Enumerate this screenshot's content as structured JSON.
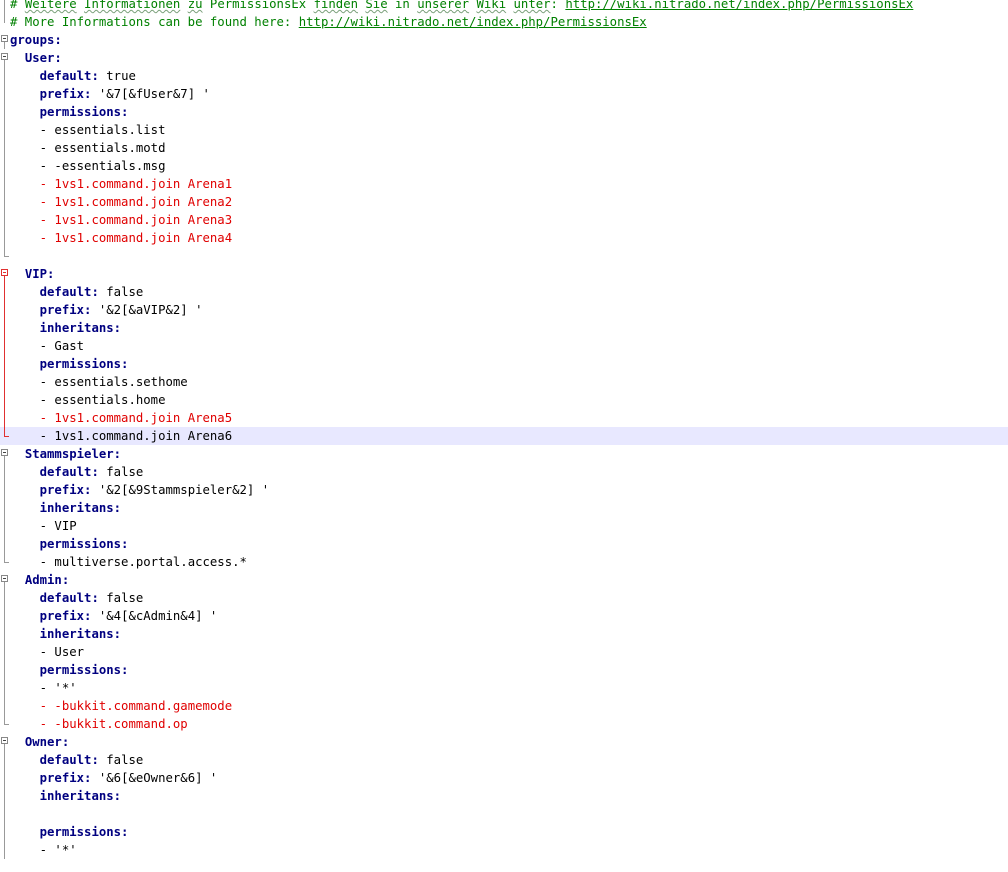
{
  "editor": {
    "current_line": 24,
    "lines": [
      {
        "indent": "",
        "parts": [
          {
            "t": "# ",
            "c": "comment"
          },
          {
            "t": "Weitere",
            "c": "comment-sq"
          },
          {
            "t": " ",
            "c": "comment"
          },
          {
            "t": "Informationen",
            "c": "comment-sq"
          },
          {
            "t": " ",
            "c": "comment"
          },
          {
            "t": "zu",
            "c": "comment-sq"
          },
          {
            "t": " PermissionsEx ",
            "c": "comment"
          },
          {
            "t": "finden",
            "c": "comment-sq"
          },
          {
            "t": " ",
            "c": "comment"
          },
          {
            "t": "Sie",
            "c": "comment-sq"
          },
          {
            "t": " in ",
            "c": "comment"
          },
          {
            "t": "unserer",
            "c": "comment-sq"
          },
          {
            "t": " ",
            "c": "comment"
          },
          {
            "t": "Wiki",
            "c": "comment-sq"
          },
          {
            "t": " ",
            "c": "comment"
          },
          {
            "t": "unter",
            "c": "comment-sq"
          },
          {
            "t": ": ",
            "c": "comment"
          },
          {
            "t": "http://wiki.nitrado.net/index.php/PermissionsEx",
            "c": "link"
          }
        ],
        "g": "vline"
      },
      {
        "indent": "",
        "parts": [
          {
            "t": "# More Informations can be found here: ",
            "c": "comment"
          },
          {
            "t": "http://wiki.nitrado.net/index.php/PermissionsEx",
            "c": "link"
          }
        ],
        "g": "vline-end"
      },
      {
        "indent": "",
        "parts": [
          {
            "t": "groups:",
            "c": "key"
          }
        ],
        "g": "fold"
      },
      {
        "indent": "  ",
        "parts": [
          {
            "t": "User:",
            "c": "key"
          }
        ],
        "g": "fold"
      },
      {
        "indent": "    ",
        "parts": [
          {
            "t": "default:",
            "c": "key"
          },
          {
            "t": " true",
            "c": "val"
          }
        ],
        "g": "vline"
      },
      {
        "indent": "    ",
        "parts": [
          {
            "t": "prefix:",
            "c": "key"
          },
          {
            "t": " '&7[&fUser&7] '",
            "c": "val"
          }
        ],
        "g": "vline"
      },
      {
        "indent": "    ",
        "parts": [
          {
            "t": "permissions:",
            "c": "key"
          }
        ],
        "g": "vline"
      },
      {
        "indent": "    ",
        "parts": [
          {
            "t": "- essentials.list",
            "c": "plain"
          }
        ],
        "g": "vline"
      },
      {
        "indent": "    ",
        "parts": [
          {
            "t": "- essentials.motd",
            "c": "plain"
          }
        ],
        "g": "vline"
      },
      {
        "indent": "    ",
        "parts": [
          {
            "t": "- -essentials.msg",
            "c": "plain"
          }
        ],
        "g": "vline"
      },
      {
        "indent": "    ",
        "parts": [
          {
            "t": "- 1vs1.command.join Arena1",
            "c": "red"
          }
        ],
        "g": "vline"
      },
      {
        "indent": "    ",
        "parts": [
          {
            "t": "- 1vs1.command.join Arena2",
            "c": "red"
          }
        ],
        "g": "vline"
      },
      {
        "indent": "    ",
        "parts": [
          {
            "t": "- 1vs1.command.join Arena3",
            "c": "red"
          }
        ],
        "g": "vline"
      },
      {
        "indent": "    ",
        "parts": [
          {
            "t": "- 1vs1.command.join Arena4",
            "c": "red"
          }
        ],
        "g": "vline"
      },
      {
        "indent": "",
        "parts": [
          {
            "t": "",
            "c": "plain"
          }
        ],
        "g": "tick"
      },
      {
        "indent": "  ",
        "parts": [
          {
            "t": "VIP:",
            "c": "key"
          }
        ],
        "g": "fold-red"
      },
      {
        "indent": "    ",
        "parts": [
          {
            "t": "default:",
            "c": "key"
          },
          {
            "t": " false",
            "c": "val"
          }
        ],
        "g": "vline-red"
      },
      {
        "indent": "    ",
        "parts": [
          {
            "t": "prefix:",
            "c": "key"
          },
          {
            "t": " '&2[&aVIP&2] '",
            "c": "val"
          }
        ],
        "g": "vline-red"
      },
      {
        "indent": "    ",
        "parts": [
          {
            "t": "inheritans:",
            "c": "key"
          }
        ],
        "g": "vline-red"
      },
      {
        "indent": "    ",
        "parts": [
          {
            "t": "- Gast",
            "c": "plain"
          }
        ],
        "g": "vline-red"
      },
      {
        "indent": "    ",
        "parts": [
          {
            "t": "permissions:",
            "c": "key"
          }
        ],
        "g": "vline-red"
      },
      {
        "indent": "    ",
        "parts": [
          {
            "t": "- essentials.sethome",
            "c": "plain"
          }
        ],
        "g": "vline-red"
      },
      {
        "indent": "    ",
        "parts": [
          {
            "t": "- essentials.home",
            "c": "plain"
          }
        ],
        "g": "vline-red"
      },
      {
        "indent": "    ",
        "parts": [
          {
            "t": "- 1vs1.command.join Arena5",
            "c": "red"
          }
        ],
        "g": "vline-red"
      },
      {
        "indent": "    ",
        "parts": [
          {
            "t": "- 1vs1.command.join Arena6",
            "c": "plain"
          }
        ],
        "g": "tick-red"
      },
      {
        "indent": "  ",
        "parts": [
          {
            "t": "Stammspieler:",
            "c": "key"
          }
        ],
        "g": "fold"
      },
      {
        "indent": "    ",
        "parts": [
          {
            "t": "default:",
            "c": "key"
          },
          {
            "t": " false",
            "c": "val"
          }
        ],
        "g": "vline"
      },
      {
        "indent": "    ",
        "parts": [
          {
            "t": "prefix:",
            "c": "key"
          },
          {
            "t": " '&2[&9Stammspieler&2] '",
            "c": "val"
          }
        ],
        "g": "vline"
      },
      {
        "indent": "    ",
        "parts": [
          {
            "t": "inheritans:",
            "c": "key"
          }
        ],
        "g": "vline"
      },
      {
        "indent": "    ",
        "parts": [
          {
            "t": "- VIP",
            "c": "plain"
          }
        ],
        "g": "vline"
      },
      {
        "indent": "    ",
        "parts": [
          {
            "t": "permissions:",
            "c": "key"
          }
        ],
        "g": "vline"
      },
      {
        "indent": "    ",
        "parts": [
          {
            "t": "- multiverse.portal.access.*",
            "c": "plain"
          }
        ],
        "g": "tick"
      },
      {
        "indent": "  ",
        "parts": [
          {
            "t": "Admin:",
            "c": "key"
          }
        ],
        "g": "fold"
      },
      {
        "indent": "    ",
        "parts": [
          {
            "t": "default:",
            "c": "key"
          },
          {
            "t": " false",
            "c": "val"
          }
        ],
        "g": "vline"
      },
      {
        "indent": "    ",
        "parts": [
          {
            "t": "prefix:",
            "c": "key"
          },
          {
            "t": " '&4[&cAdmin&4] '",
            "c": "val"
          }
        ],
        "g": "vline"
      },
      {
        "indent": "    ",
        "parts": [
          {
            "t": "inheritans:",
            "c": "key"
          }
        ],
        "g": "vline"
      },
      {
        "indent": "    ",
        "parts": [
          {
            "t": "- User",
            "c": "plain"
          }
        ],
        "g": "vline"
      },
      {
        "indent": "    ",
        "parts": [
          {
            "t": "permissions:",
            "c": "key"
          }
        ],
        "g": "vline"
      },
      {
        "indent": "    ",
        "parts": [
          {
            "t": "- '*'",
            "c": "plain"
          }
        ],
        "g": "vline"
      },
      {
        "indent": "    ",
        "parts": [
          {
            "t": "- -bukkit.command.gamemode",
            "c": "red"
          }
        ],
        "g": "vline"
      },
      {
        "indent": "    ",
        "parts": [
          {
            "t": "- -bukkit.command.op",
            "c": "red"
          }
        ],
        "g": "tick"
      },
      {
        "indent": "  ",
        "parts": [
          {
            "t": "Owner:",
            "c": "key"
          }
        ],
        "g": "fold"
      },
      {
        "indent": "    ",
        "parts": [
          {
            "t": "default:",
            "c": "key"
          },
          {
            "t": " false",
            "c": "val"
          }
        ],
        "g": "vline"
      },
      {
        "indent": "    ",
        "parts": [
          {
            "t": "prefix:",
            "c": "key"
          },
          {
            "t": " '&6[&eOwner&6] '",
            "c": "val"
          }
        ],
        "g": "vline"
      },
      {
        "indent": "    ",
        "parts": [
          {
            "t": "inheritans:",
            "c": "key"
          }
        ],
        "g": "vline"
      },
      {
        "indent": "",
        "parts": [
          {
            "t": "",
            "c": "plain"
          }
        ],
        "g": "vline"
      },
      {
        "indent": "    ",
        "parts": [
          {
            "t": "permissions:",
            "c": "key"
          }
        ],
        "g": "vline"
      },
      {
        "indent": "    ",
        "parts": [
          {
            "t": "- '*'",
            "c": "plain"
          }
        ],
        "g": "vline"
      }
    ]
  }
}
